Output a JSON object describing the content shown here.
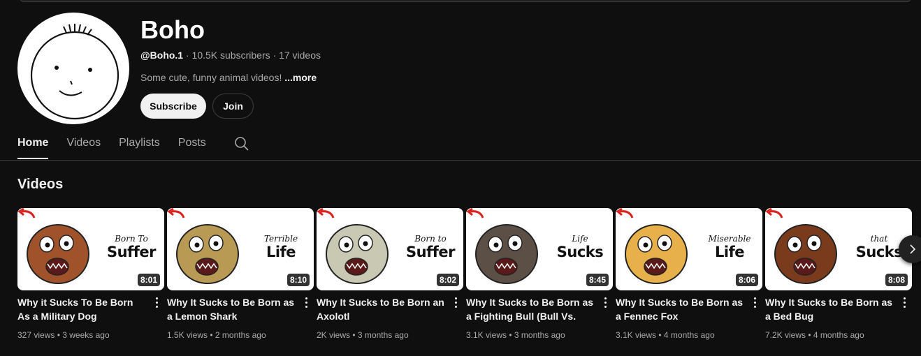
{
  "channel": {
    "name": "Boho",
    "handle": "@Boho.1",
    "subscribers": "10.5K subscribers",
    "videos_count": "17 videos",
    "separator": " · ",
    "description": "Some cute, funny animal videos!",
    "more_label": "...more"
  },
  "buttons": {
    "subscribe": "Subscribe",
    "join": "Join"
  },
  "tabs": [
    {
      "label": "Home",
      "active": true
    },
    {
      "label": "Videos",
      "active": false
    },
    {
      "label": "Playlists",
      "active": false
    },
    {
      "label": "Posts",
      "active": false
    }
  ],
  "section": {
    "title": "Videos"
  },
  "videos": [
    {
      "title": "Why it Sucks To Be Born As a Military Dog",
      "duration": "8:01",
      "views": "327 views",
      "age": "3 weeks ago",
      "caption_top": "Born To",
      "caption_big": "Suffer",
      "creature_color": "#a0532a"
    },
    {
      "title": "Why It Sucks to Be Born as a Lemon Shark",
      "duration": "8:10",
      "views": "1.5K views",
      "age": "2 months ago",
      "caption_top": "Terrible",
      "caption_big": "Life",
      "creature_color": "#b99a55"
    },
    {
      "title": "Why It Sucks to Be Born an Axolotl",
      "duration": "8:02",
      "views": "2K views",
      "age": "3 months ago",
      "caption_top": "Born to",
      "caption_big": "Suffer",
      "creature_color": "#c9c8b2"
    },
    {
      "title": "Why It Sucks to Be Born as a Fighting Bull (Bull Vs. Bull…",
      "duration": "8:45",
      "views": "3.1K views",
      "age": "3 months ago",
      "caption_top": "Life",
      "caption_big": "Sucks",
      "creature_color": "#5c4f45"
    },
    {
      "title": "Why It Sucks to Be Born as a Fennec Fox",
      "duration": "8:06",
      "views": "3.1K views",
      "age": "4 months ago",
      "caption_top": "Miserable",
      "caption_big": "Life",
      "creature_color": "#e8b04a"
    },
    {
      "title": "Why It Sucks to Be Born as a Bed Bug",
      "duration": "8:08",
      "views": "7.2K views",
      "age": "4 months ago",
      "caption_top": "that",
      "caption_big": "Sucks",
      "creature_color": "#7a3a1c"
    }
  ],
  "meta_separator": " • ",
  "colors": {
    "background": "#0f0f0f",
    "text": "#f1f1f1",
    "muted": "#aaaaaa",
    "arrow_red": "#d9231e"
  }
}
